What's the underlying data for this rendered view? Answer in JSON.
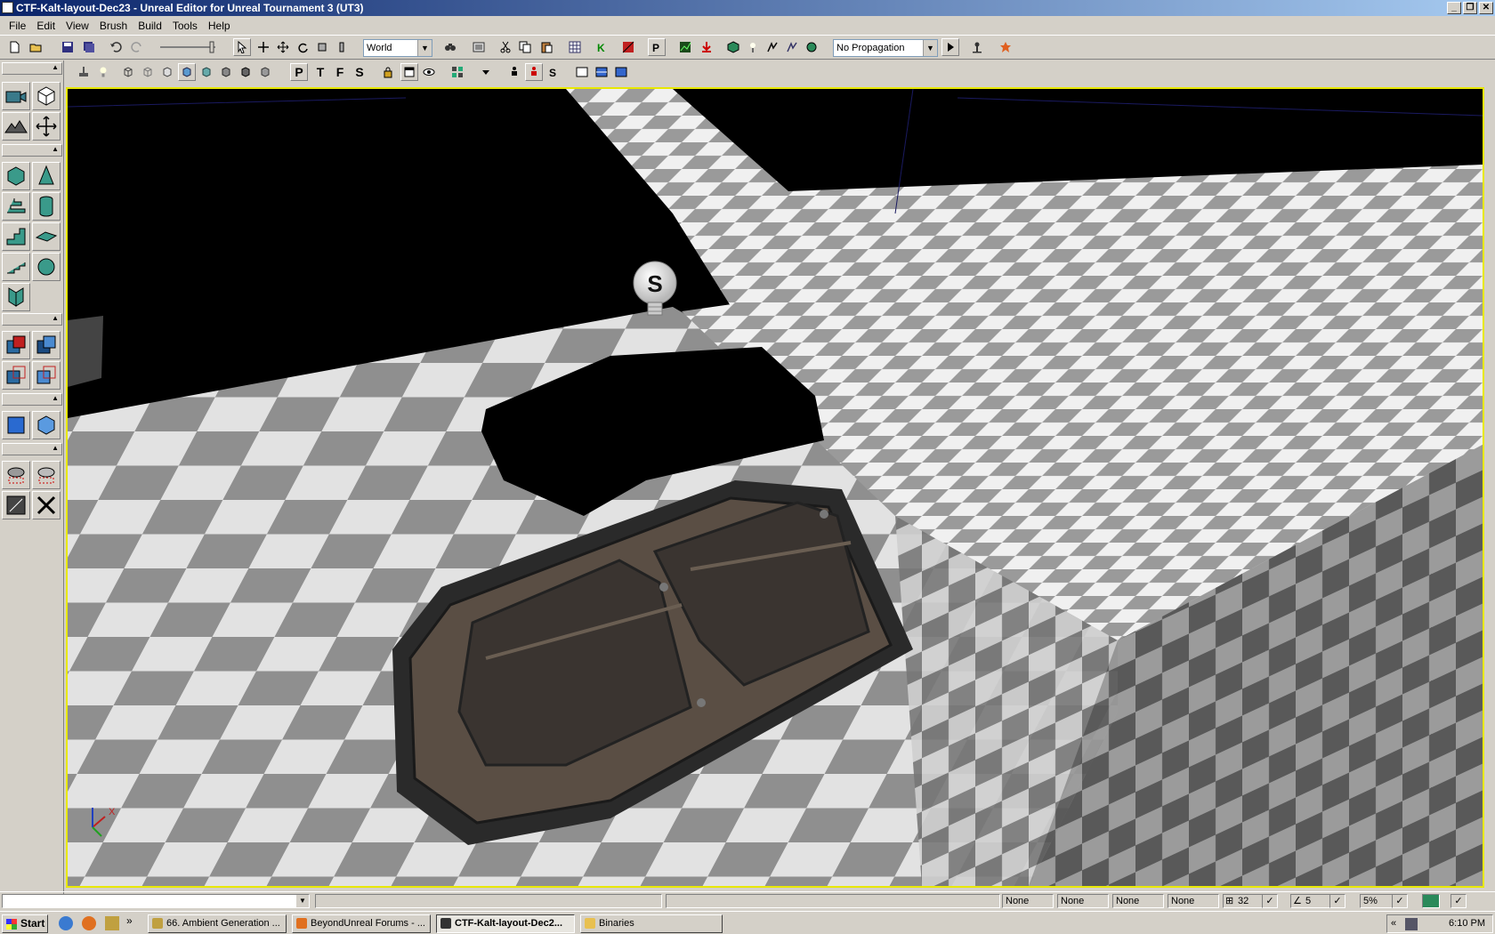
{
  "window": {
    "title": "CTF-Kalt-layout-Dec23 - Unreal Editor for Unreal Tournament 3 (UT3)"
  },
  "menu": [
    "File",
    "Edit",
    "View",
    "Brush",
    "Build",
    "Tools",
    "Help"
  ],
  "toolbar": {
    "coord_system": "World",
    "propagation": "No Propagation",
    "view_letters": [
      "P",
      "T",
      "F",
      "S"
    ]
  },
  "viewport": {
    "light_actor_label": "S",
    "axis_label": "X"
  },
  "status": {
    "fields": [
      "None",
      "None",
      "None",
      "None"
    ],
    "grid_size": "32",
    "rotation_snap": "5",
    "scale_snap": "5%"
  },
  "taskbar": {
    "start_label": "Start",
    "tasks": [
      {
        "label": "66. Ambient Generation ..."
      },
      {
        "label": "BeyondUnreal Forums - ..."
      },
      {
        "label": "CTF-Kalt-layout-Dec2..."
      },
      {
        "label": "Binaries"
      }
    ],
    "clock": "6:10 PM"
  }
}
